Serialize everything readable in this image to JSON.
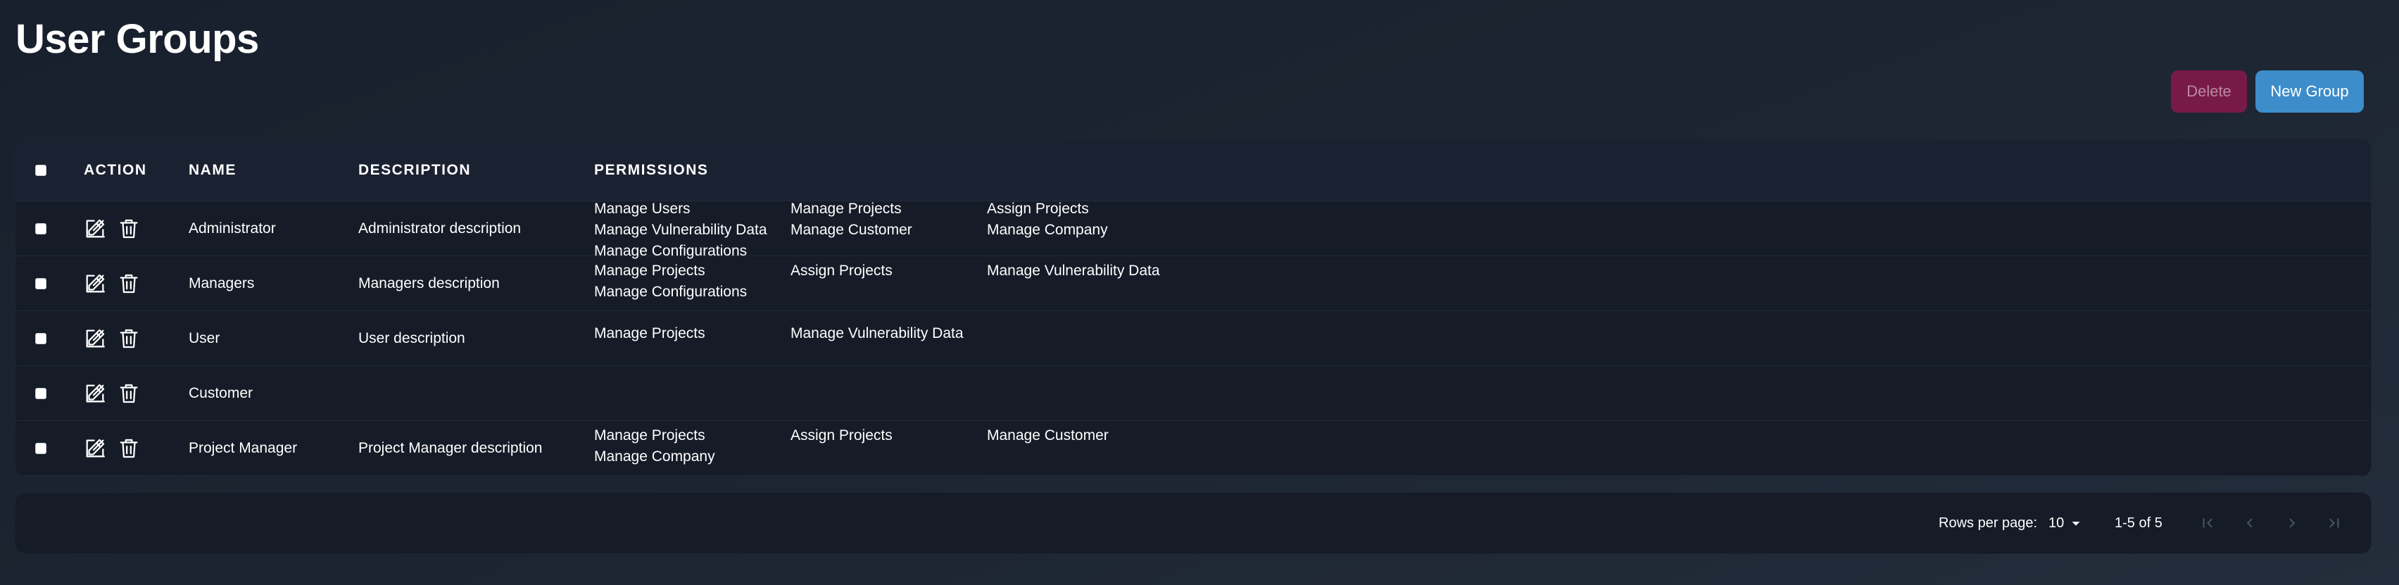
{
  "page": {
    "title": "User Groups"
  },
  "toolbar": {
    "delete_label": "Delete",
    "new_label": "New Group"
  },
  "table": {
    "headers": {
      "action": "ACTION",
      "name": "NAME",
      "description": "DESCRIPTION",
      "permissions": "PERMISSIONS"
    },
    "rows": [
      {
        "name": "Administrator",
        "description": "Administrator description",
        "permissions": [
          "Manage Users",
          "Manage Projects",
          "Assign Projects",
          "Manage Vulnerability Data",
          "Manage Customer",
          "Manage Company",
          "Manage Configurations"
        ]
      },
      {
        "name": "Managers",
        "description": "Managers description",
        "permissions": [
          "Manage Projects",
          "Assign Projects",
          "Manage Vulnerability Data",
          "Manage Configurations"
        ]
      },
      {
        "name": "User",
        "description": "User description",
        "permissions": [
          "Manage Projects",
          "Manage Vulnerability Data"
        ]
      },
      {
        "name": "Customer",
        "description": "",
        "permissions": []
      },
      {
        "name": "Project Manager",
        "description": "Project Manager description",
        "permissions": [
          "Manage Projects",
          "Assign Projects",
          "Manage Customer",
          "Manage Company"
        ]
      }
    ]
  },
  "pagination": {
    "rows_per_page_label": "Rows per page:",
    "rows_per_page_value": "10",
    "range_text": "1-5 of 5"
  },
  "icons": {
    "edit": "edit-icon",
    "delete": "trash-icon",
    "dropdown": "caret-down-icon",
    "first": "first-page-icon",
    "prev": "chevron-left-icon",
    "next": "chevron-right-icon",
    "last": "last-page-icon"
  },
  "colors": {
    "background": "#1d2532",
    "card": "#151b27",
    "delete_button": "#781a47",
    "new_button": "#3c8dca"
  }
}
